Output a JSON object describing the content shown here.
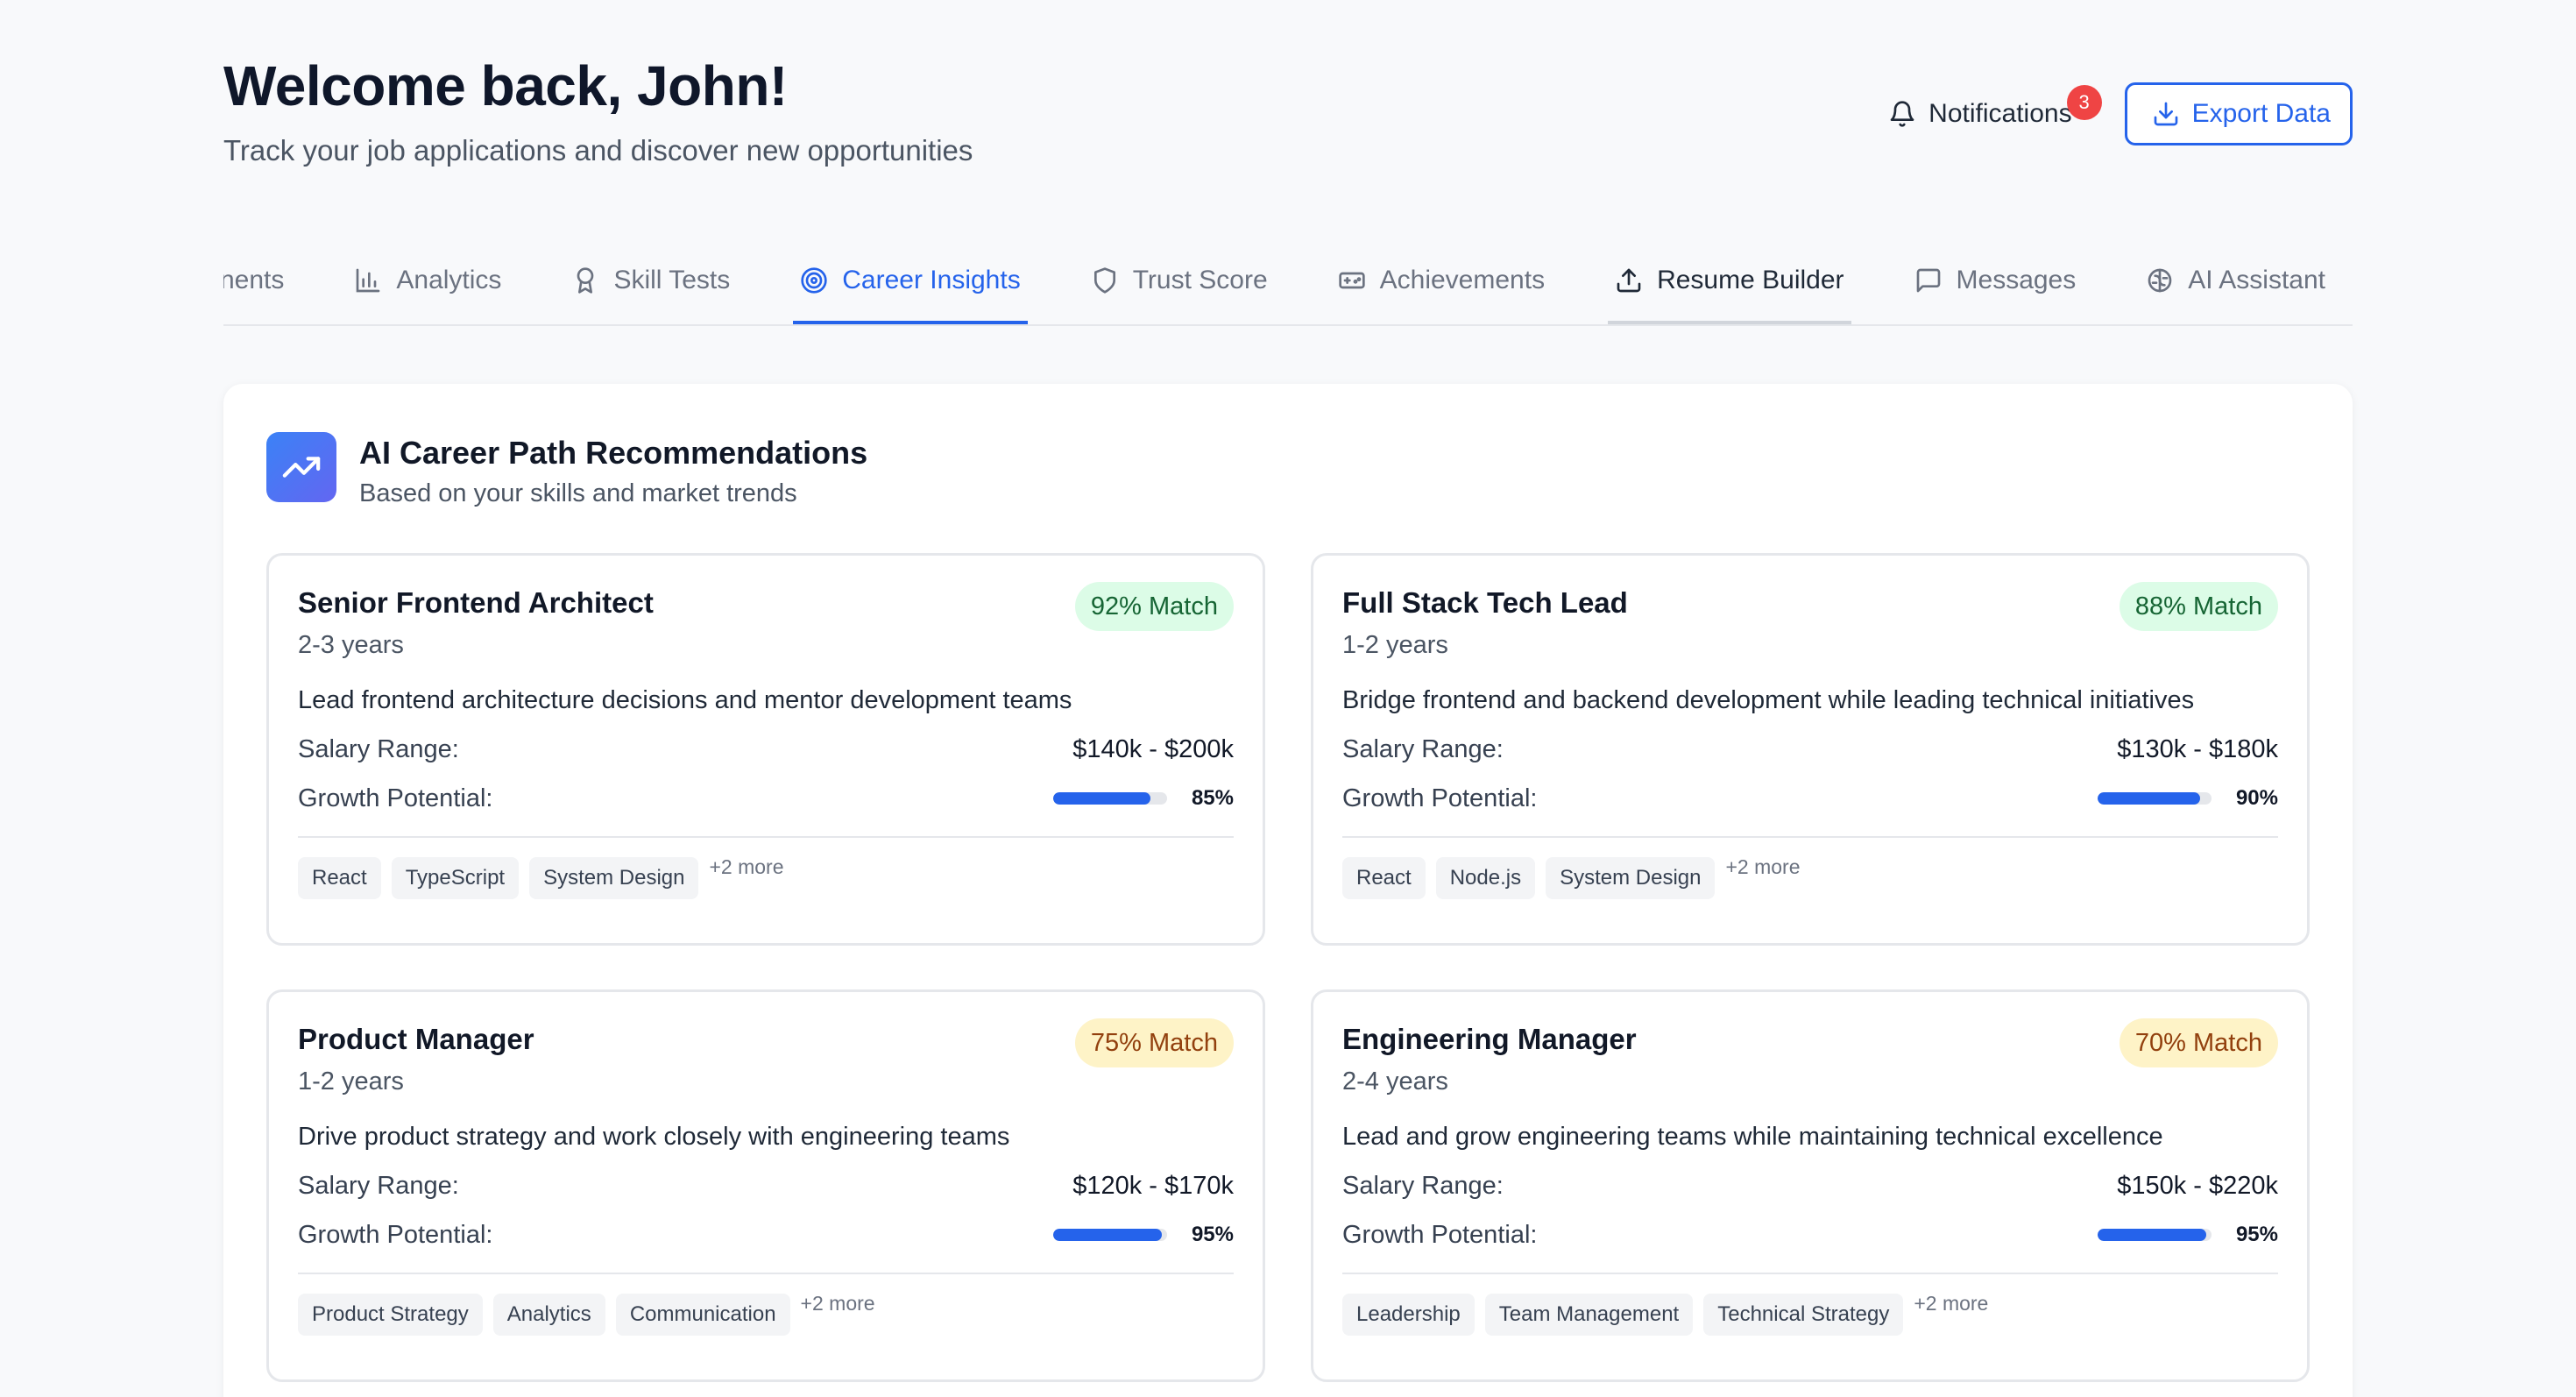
{
  "header": {
    "title": "Welcome back, John!",
    "subtitle": "Track your job applications and discover new opportunities",
    "notifications_label": "Notifications",
    "notifications_count": "3",
    "export_label": "Export Data"
  },
  "tabs": [
    {
      "label": "nents",
      "icon": "partial"
    },
    {
      "label": "Analytics",
      "icon": "bar-chart-icon"
    },
    {
      "label": "Skill Tests",
      "icon": "award-icon"
    },
    {
      "label": "Career Insights",
      "icon": "target-icon",
      "active": true
    },
    {
      "label": "Trust Score",
      "icon": "shield-icon"
    },
    {
      "label": "Achievements",
      "icon": "gamepad-icon"
    },
    {
      "label": "Resume Builder",
      "icon": "upload-icon",
      "hover": true
    },
    {
      "label": "Messages",
      "icon": "message-icon"
    },
    {
      "label": "AI Assistant",
      "icon": "brain-icon"
    }
  ],
  "panel": {
    "title": "AI Career Path Recommendations",
    "subtitle": "Based on your skills and market trends",
    "salary_label": "Salary Range:",
    "growth_label": "Growth Potential:",
    "cards": [
      {
        "title": "Senior Frontend Architect",
        "years": "2-3 years",
        "match": "92% Match",
        "match_color": "green",
        "description": "Lead frontend architecture decisions and mentor development teams",
        "salary": "$140k - $200k",
        "growth": "85%",
        "growth_value": 85,
        "tags": [
          "React",
          "TypeScript",
          "System Design"
        ],
        "more": "+2 more"
      },
      {
        "title": "Full Stack Tech Lead",
        "years": "1-2 years",
        "match": "88% Match",
        "match_color": "green",
        "description": "Bridge frontend and backend development while leading technical initiatives",
        "salary": "$130k - $180k",
        "growth": "90%",
        "growth_value": 90,
        "tags": [
          "React",
          "Node.js",
          "System Design"
        ],
        "more": "+2 more"
      },
      {
        "title": "Product Manager",
        "years": "1-2 years",
        "match": "75% Match",
        "match_color": "amber",
        "description": "Drive product strategy and work closely with engineering teams",
        "salary": "$120k - $170k",
        "growth": "95%",
        "growth_value": 95,
        "tags": [
          "Product Strategy",
          "Analytics",
          "Communication"
        ],
        "more": "+2 more"
      },
      {
        "title": "Engineering Manager",
        "years": "2-4 years",
        "match": "70% Match",
        "match_color": "amber",
        "description": "Lead and grow engineering teams while maintaining technical excellence",
        "salary": "$150k - $220k",
        "growth": "95%",
        "growth_value": 95,
        "tags": [
          "Leadership",
          "Team Management",
          "Technical Strategy"
        ],
        "more": "+2 more"
      }
    ]
  },
  "colors": {
    "accent": "#2563eb",
    "badge": "#ef4444",
    "match_green_bg": "#dcfce7",
    "match_amber_bg": "#fef3c7"
  }
}
